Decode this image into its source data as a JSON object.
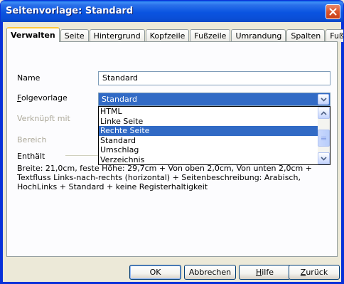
{
  "window": {
    "title": "Seitenvorlage: Standard"
  },
  "tabs": [
    {
      "label": "Verwalten",
      "active": true
    },
    {
      "label": "Seite",
      "active": false
    },
    {
      "label": "Hintergrund",
      "active": false
    },
    {
      "label": "Kopfzeile",
      "active": false
    },
    {
      "label": "Fußzeile",
      "active": false
    },
    {
      "label": "Umrandung",
      "active": false
    },
    {
      "label": "Spalten",
      "active": false
    },
    {
      "label": "Fußnote",
      "active": false
    }
  ],
  "form": {
    "name_label": "Name",
    "name_value": "Standard",
    "folgevorlage_label_accel": "F",
    "folgevorlage_label_rest": "olgevorlage",
    "folgevorlage_value": "Standard",
    "verknuepft_label": "Verknüpft mit",
    "bereich_label": "Bereich",
    "enthaelt_label": "Enthält"
  },
  "dropdown": {
    "items": [
      {
        "label": "HTML",
        "selected": false
      },
      {
        "label": "Linke Seite",
        "selected": false
      },
      {
        "label": "Rechte Seite",
        "selected": true
      },
      {
        "label": "Standard",
        "selected": false
      },
      {
        "label": "Umschlag",
        "selected": false
      },
      {
        "label": "Verzeichnis",
        "selected": false
      }
    ]
  },
  "description": "Breite: 21,0cm, feste Höhe: 29,7cm + Von oben 2,0cm, Von unten 2,0cm + Textfluss Links-nach-rechts (horizontal) + Seitenbeschreibung: Arabisch, HochLinks + Standard + keine Registerhaltigkeit",
  "buttons": {
    "ok": "OK",
    "abbrechen": "Abbrechen",
    "hilfe_accel": "H",
    "hilfe_rest": "ilfe",
    "zurueck_accel": "Z",
    "zurueck_rest": "urück"
  },
  "colors": {
    "titlebar": "#0a54e0",
    "selection": "#316ac5",
    "tab_highlight": "#ffc83c",
    "close_button": "#d9542b"
  }
}
